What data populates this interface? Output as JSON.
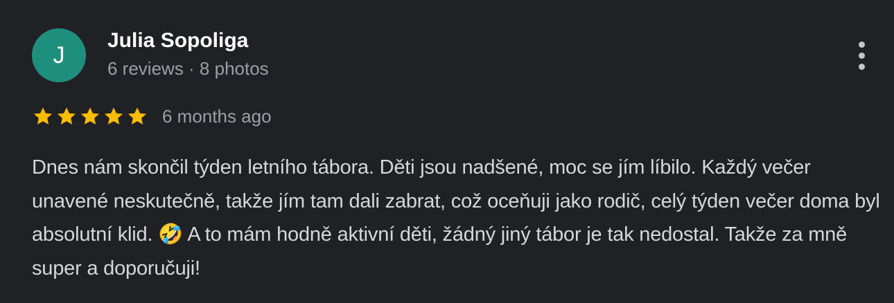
{
  "author": {
    "avatar_letter": "J",
    "avatar_color": "#1f8f7d",
    "name": "Julia Sopoliga",
    "meta": "6 reviews · 8 photos"
  },
  "review": {
    "rating": 5,
    "rating_max": 5,
    "star_color": "#fbbc04",
    "date": "6 months ago",
    "text": "Dnes nám skončil týden letního tábora. Děti jsou nadšené, moc se jím líbilo. Každý večer unavené neskutečně, takže jím tam dali zabrat, což oceňuji jako rodič, celý týden večer doma byl absolutní klid. 🤣 A to mám hodně aktivní děti, žádný jiný tábor je tak nedostal. Takže za mně super a doporučuji!"
  },
  "icons": {
    "more": "more-vert-icon",
    "star": "star-icon"
  }
}
